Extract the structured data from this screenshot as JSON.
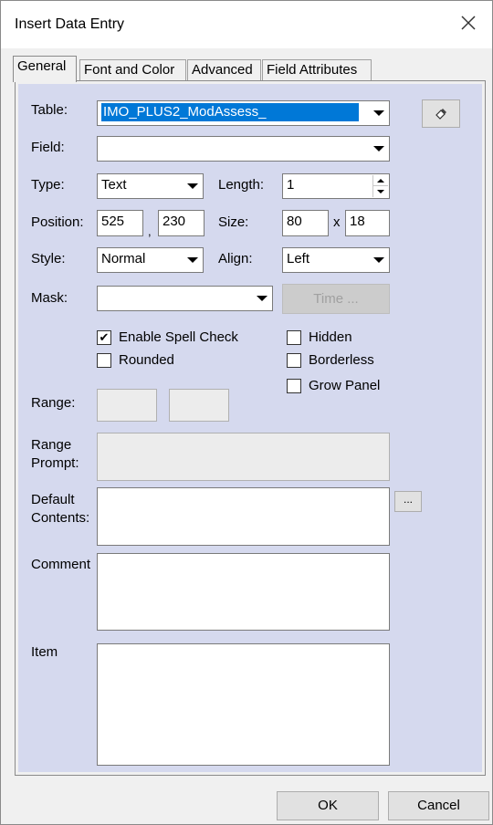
{
  "window": {
    "title": "Insert Data Entry"
  },
  "tabs": [
    {
      "label": "General",
      "active": true
    },
    {
      "label": "Font and Color",
      "active": false
    },
    {
      "label": "Advanced",
      "active": false
    },
    {
      "label": "Field Attributes",
      "active": false
    }
  ],
  "form": {
    "table_label": "Table:",
    "table_value": "IMO_PLUS2_ModAssess_",
    "field_label": "Field:",
    "field_value": "",
    "type_label": "Type:",
    "type_value": "Text",
    "length_label": "Length:",
    "length_value": "1",
    "position_label": "Position:",
    "position_x": "525",
    "position_comma": ",",
    "position_y": "230",
    "size_label": "Size:",
    "size_w": "80",
    "size_x": "x",
    "size_h": "18",
    "style_label": "Style:",
    "style_value": "Normal",
    "align_label": "Align:",
    "align_value": "Left",
    "mask_label": "Mask:",
    "mask_value": "",
    "time_button": "Time ...",
    "checkboxes": {
      "spell_check": {
        "label": "Enable Spell Check",
        "checked": true,
        "mark": "✔"
      },
      "rounded": {
        "label": "Rounded",
        "checked": false
      },
      "hidden": {
        "label": "Hidden",
        "checked": false
      },
      "borderless": {
        "label": "Borderless",
        "checked": false
      },
      "grow_panel": {
        "label": "Grow Panel",
        "checked": false
      }
    },
    "range_label": "Range:",
    "range_prompt_label_1": "Range",
    "range_prompt_label_2": "Prompt:",
    "default_label_1": "Default",
    "default_label_2": "Contents:",
    "default_browse": "...",
    "comment_label": "Comment",
    "item_label": "Item"
  },
  "footer": {
    "ok": "OK",
    "cancel": "Cancel"
  },
  "colors": {
    "panel_bg": "#d5d9ee",
    "selection": "#0078d7"
  }
}
